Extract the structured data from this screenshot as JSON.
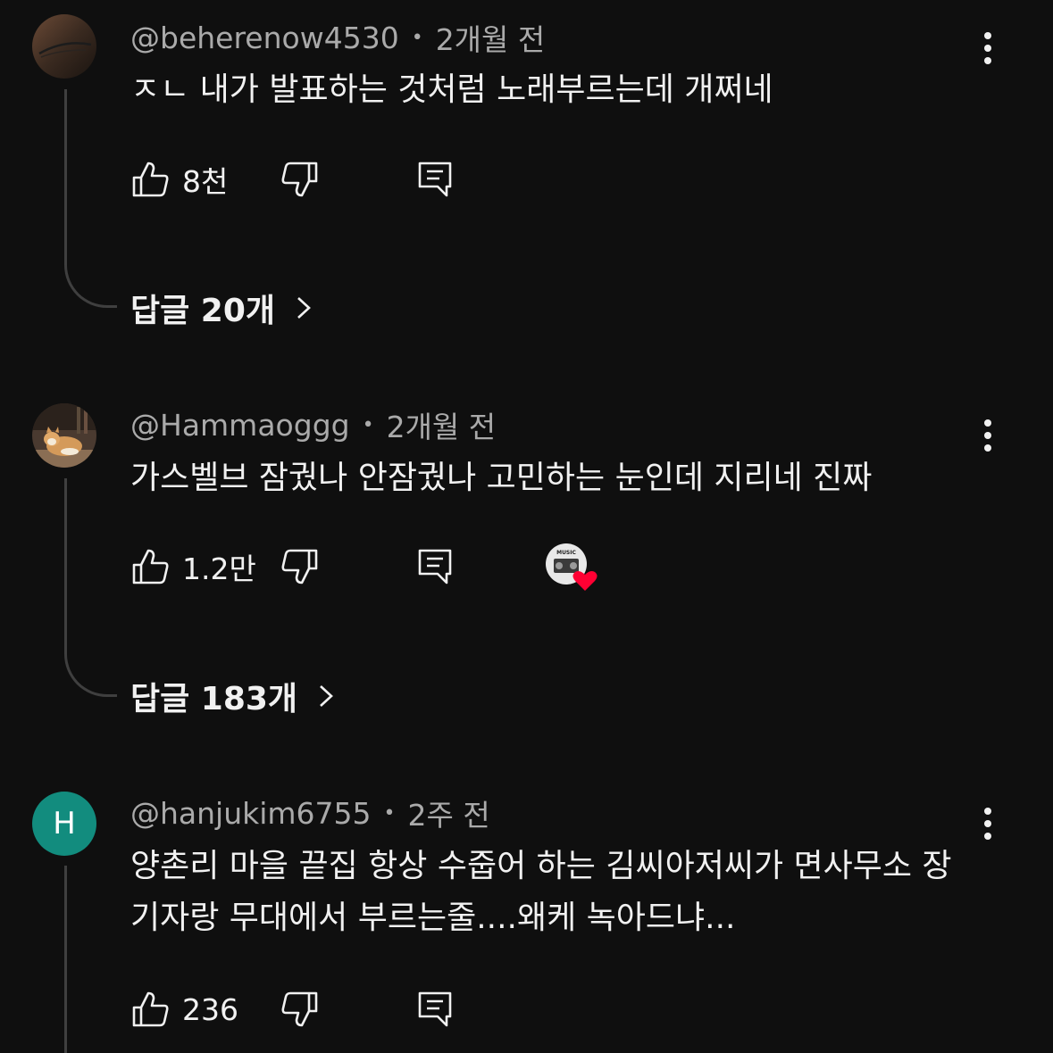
{
  "comments": [
    {
      "handle": "@beherenow4530",
      "time": "2개월 전",
      "text": "ㅈㄴ 내가 발표하는 것처럼 노래부르는데 개쩌네",
      "likes": "8천",
      "replies_label": "답글 20개",
      "avatar_icon": "tattoo-photo-avatar",
      "dot": "•"
    },
    {
      "handle": "@Hammaoggg",
      "time": "2개월 전",
      "text": "가스벨브 잠궜나 안잠궜나 고민하는 눈인데 지리네 진짜",
      "likes": "1.2만",
      "replies_label": "답글 183개",
      "avatar_icon": "corgi-photo-avatar",
      "creator_heart_badge": "MUSIC",
      "heart_color": "#ff0033",
      "dot": "•"
    },
    {
      "handle": "@hanjukim6755",
      "time": "2주 전",
      "text": "양촌리 마을 끝집 항상 수줍어 하는 김씨아저씨가 면사무소 장기자랑 무대에서 부르는줄....왜케 녹아드냐...",
      "likes": "236",
      "avatar_letter": "H",
      "avatar_color": "#128c7e",
      "dot": "•"
    }
  ],
  "colors": {
    "background": "#0f0f0f",
    "primary_text": "#f1f1f1",
    "secondary_text": "#aaaaaa",
    "thread_line": "#3f3f3f"
  }
}
